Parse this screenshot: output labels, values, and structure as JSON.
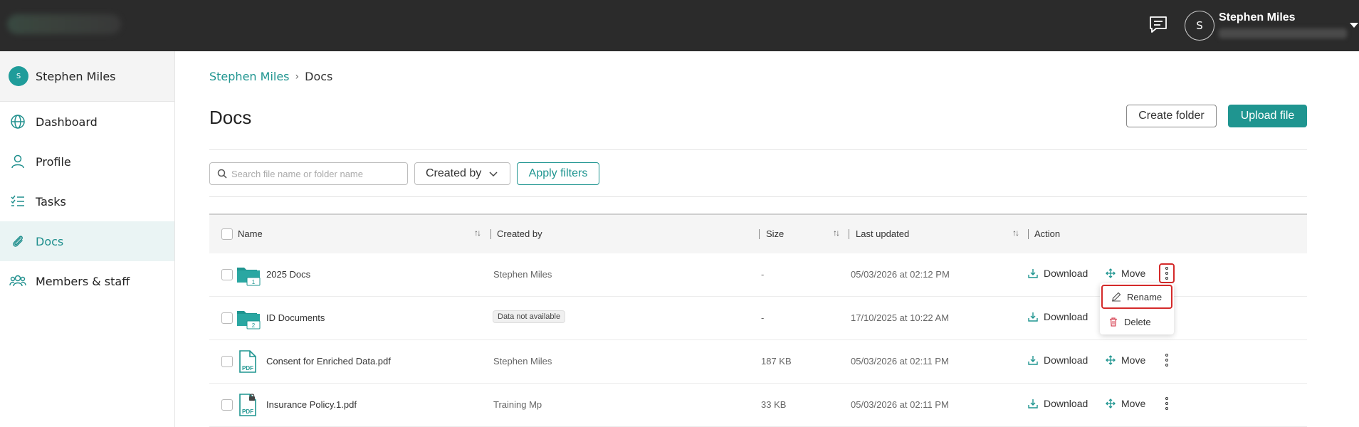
{
  "topbar": {
    "user_initial": "S",
    "user_name": "Stephen Miles"
  },
  "sidebar": {
    "user": {
      "initial": "S",
      "name": "Stephen Miles"
    },
    "items": [
      {
        "label": "Dashboard",
        "icon": "globe-icon"
      },
      {
        "label": "Profile",
        "icon": "user-icon"
      },
      {
        "label": "Tasks",
        "icon": "checklist-icon"
      },
      {
        "label": "Docs",
        "icon": "paperclip-icon",
        "active": true
      },
      {
        "label": "Members & staff",
        "icon": "members-icon"
      }
    ]
  },
  "breadcrumb": {
    "root": "Stephen Miles",
    "current": "Docs"
  },
  "page": {
    "title": "Docs",
    "create_folder_label": "Create folder",
    "upload_file_label": "Upload file"
  },
  "filters": {
    "search_placeholder": "Search file name or folder name",
    "created_by_label": "Created by",
    "apply_label": "Apply filters"
  },
  "table": {
    "headers": {
      "name": "Name",
      "created_by": "Created by",
      "size": "Size",
      "last_updated": "Last updated",
      "action": "Action"
    },
    "actions": {
      "download": "Download",
      "move": "Move"
    },
    "rows": [
      {
        "name": "2025 Docs",
        "type": "folder",
        "folder_count": "1",
        "created_by": "Stephen Miles",
        "size": "-",
        "last_updated": "05/03/2026 at 02:12 PM"
      },
      {
        "name": "ID Documents",
        "type": "folder",
        "folder_count": "2",
        "created_by": "Data not available",
        "size": "-",
        "last_updated": "17/10/2025 at 10:22 AM"
      },
      {
        "name": "Consent for Enriched Data.pdf",
        "type": "pdf",
        "pdf_label": "PDF",
        "created_by": "Stephen Miles",
        "size": "187 KB",
        "last_updated": "05/03/2026 at 02:11 PM"
      },
      {
        "name": "Insurance Policy.1.pdf",
        "type": "pdf-locked",
        "pdf_label": "PDF",
        "created_by": "Training Mp",
        "size": "33 KB",
        "last_updated": "05/03/2026 at 02:11 PM"
      }
    ]
  },
  "row_menu": {
    "rename_label": "Rename",
    "delete_label": "Delete"
  },
  "colors": {
    "accent": "#1f9590",
    "topbar": "#2b2b2b",
    "highlight": "#d42a2a",
    "delete": "#d84a5a"
  }
}
